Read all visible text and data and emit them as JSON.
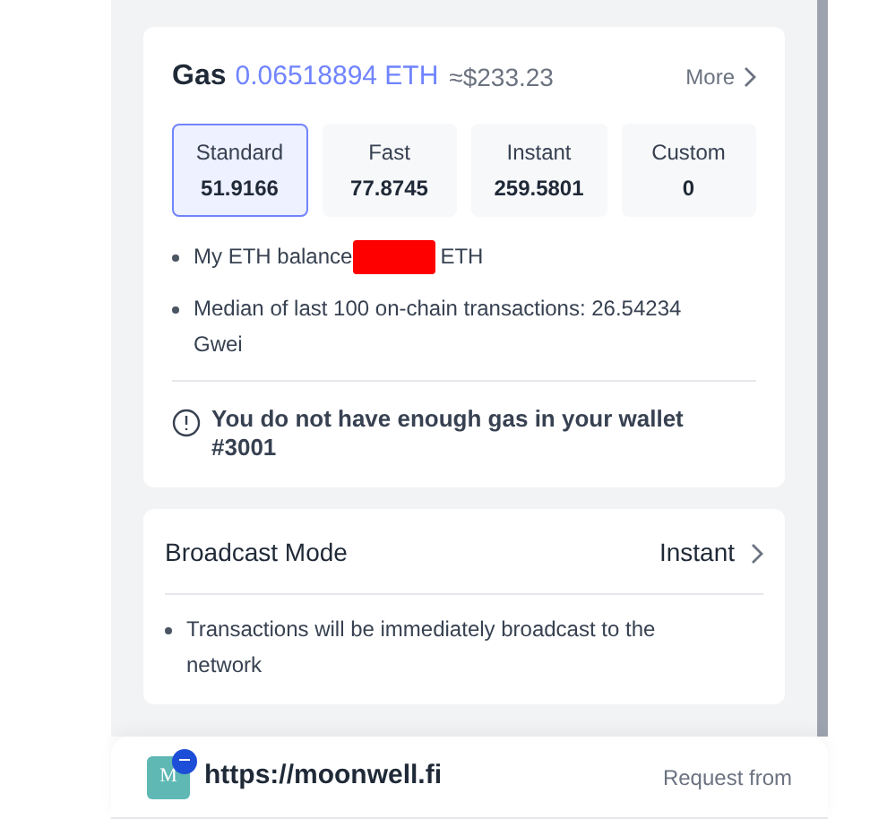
{
  "gas": {
    "label": "Gas",
    "amount": "0.06518894 ETH",
    "fiat": "≈$233.23",
    "more": "More"
  },
  "speeds": [
    {
      "name": "Standard",
      "value": "51.9166",
      "selected": true
    },
    {
      "name": "Fast",
      "value": "77.8745",
      "selected": false
    },
    {
      "name": "Instant",
      "value": "259.5801",
      "selected": false
    },
    {
      "name": "Custom",
      "value": "0",
      "selected": false
    }
  ],
  "notes": [
    {
      "kind": "balance",
      "prefix": "My ETH balance",
      "suffix": "ETH",
      "redacted": true
    },
    {
      "kind": "text",
      "text": "Median of last 100 on-chain transactions: 26.54234 Gwei"
    }
  ],
  "warning": "You do not have enough gas in your wallet #3001",
  "broadcast": {
    "label": "Broadcast Mode",
    "value": "Instant",
    "notes": [
      "Transactions will be immediately broadcast to the network"
    ]
  },
  "request": {
    "logo_letter": "M",
    "url": "https://moonwell.fi",
    "label": "Request from"
  }
}
